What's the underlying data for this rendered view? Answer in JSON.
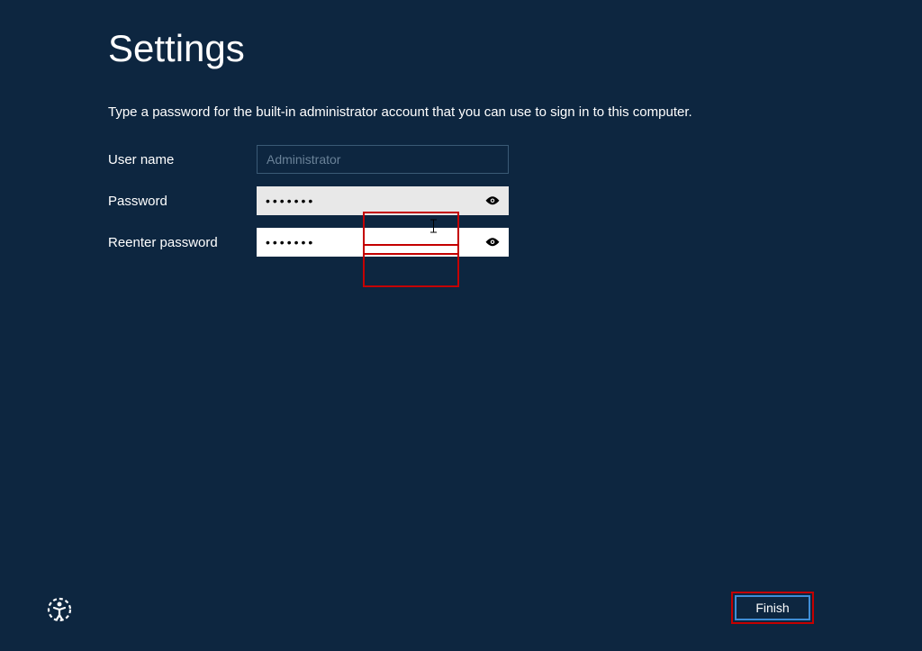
{
  "title": "Settings",
  "instruction": "Type a password for the built-in administrator account that you can use to sign in to this computer.",
  "form": {
    "username_label": "User name",
    "username_value": "Administrator",
    "password_label": "Password",
    "password_value": "•••••••",
    "reenter_label": "Reenter password",
    "reenter_value": "•••••••"
  },
  "buttons": {
    "finish": "Finish"
  }
}
